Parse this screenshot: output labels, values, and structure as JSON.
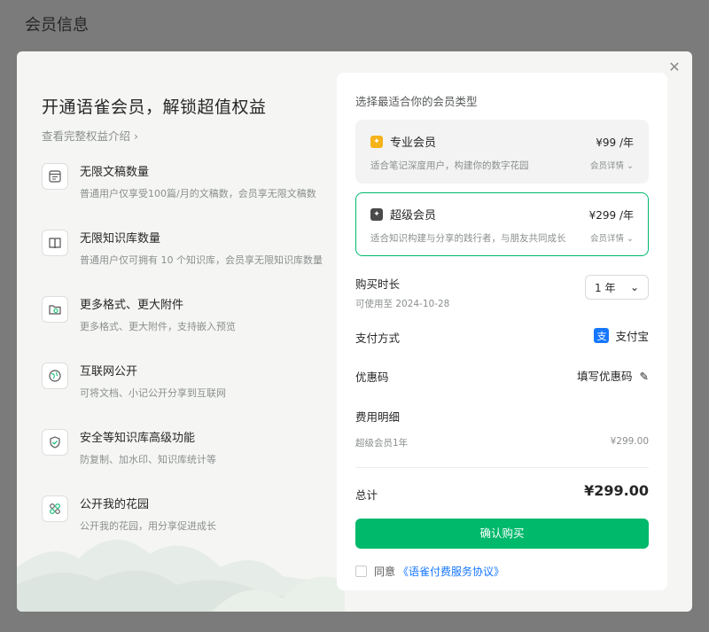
{
  "page": {
    "title": "会员信息"
  },
  "modal": {
    "close_symbol": "✕",
    "headline": "开通语雀会员，解锁超值权益",
    "benefits_link": "查看完整权益介绍 ›",
    "features": [
      {
        "icon": "document-icon",
        "title": "无限文稿数量",
        "desc": "普通用户仅享受100篇/月的文稿数，会员享无限文稿数"
      },
      {
        "icon": "book-icon",
        "title": "无限知识库数量",
        "desc": "普通用户仅可拥有 10 个知识库，会员享无限知识库数量"
      },
      {
        "icon": "attachment-folder-icon",
        "title": "更多格式、更大附件",
        "desc": "更多格式、更大附件，支持嵌入预览"
      },
      {
        "icon": "globe-icon",
        "title": "互联网公开",
        "desc": "可将文档、小记公开分享到互联网"
      },
      {
        "icon": "shield-check-icon",
        "title": "安全等知识库高级功能",
        "desc": "防复制、加水印、知识库统计等"
      },
      {
        "icon": "garden-icon",
        "title": "公开我的花园",
        "desc": "公开我的花园，用分享促进成长"
      }
    ],
    "purchase": {
      "choose_label": "选择最适合你的会员类型",
      "plans": [
        {
          "name": "专业会员",
          "price": "¥99 /年",
          "desc": "适合笔记深度用户，构建你的数字花园",
          "detail": "会员详情",
          "badge_color": "#f5b31a"
        },
        {
          "name": "超级会员",
          "price": "¥299 /年",
          "desc": "适合知识构建与分享的践行者，与朋友共同成长",
          "detail": "会员详情",
          "badge_color": "#4a4a4a"
        }
      ],
      "selected_plan": "超级会员",
      "duration_label": "购买时长",
      "valid_until": "可使用至 2024-10-28",
      "duration_value": "1 年",
      "payment_label": "支付方式",
      "payment_method": "支付宝",
      "coupon_label": "优惠码",
      "coupon_action": "填写优惠码",
      "fees_label": "费用明细",
      "fee_item": "超级会员1年",
      "fee_amount": "¥299.00",
      "total_label": "总计",
      "total_amount": "¥299.00",
      "confirm_label": "确认购买",
      "agree_prefix": "同意",
      "agree_link": "《语雀付费服务协议》"
    }
  },
  "colors": {
    "accent": "#00b96b",
    "link": "#1677ff",
    "overlay": "#7b7b7b"
  }
}
